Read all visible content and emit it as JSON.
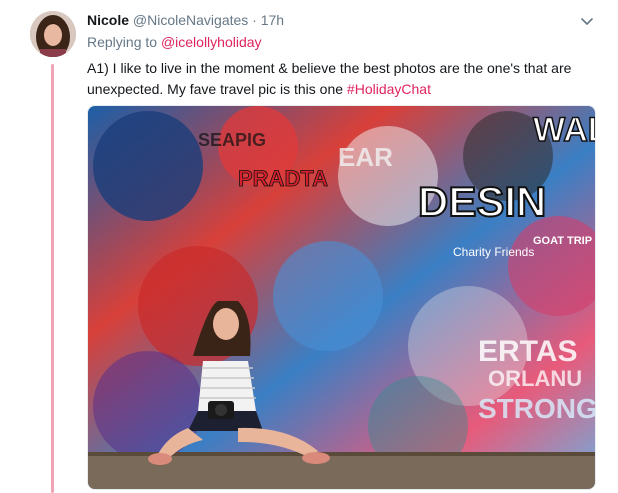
{
  "tweet": {
    "display_name": "Nicole",
    "handle": "@NicoleNavigates",
    "separator": "·",
    "time": "17h",
    "replying_prefix": "Replying to",
    "replying_to": "@icelollyholiday",
    "text_before": "A1) I like to live in the moment & believe the best photos are the one's that are unexpected. My fave travel pic is this one ",
    "hashtag": "#HolidayChat"
  },
  "photo": {
    "graffiti_words": [
      "WAL",
      "DESIN",
      "EAR",
      "GOAT TRIP",
      "Charity Friends",
      "ERTAS",
      "ORLANU",
      "STRONG",
      "SEAPIG",
      "PRADTA"
    ]
  },
  "icons": {
    "more": "chevron-down-icon",
    "avatar": "avatar"
  },
  "colors": {
    "accent": "#e0245e",
    "thread_line": "#f2a4b7",
    "muted": "#657786"
  }
}
